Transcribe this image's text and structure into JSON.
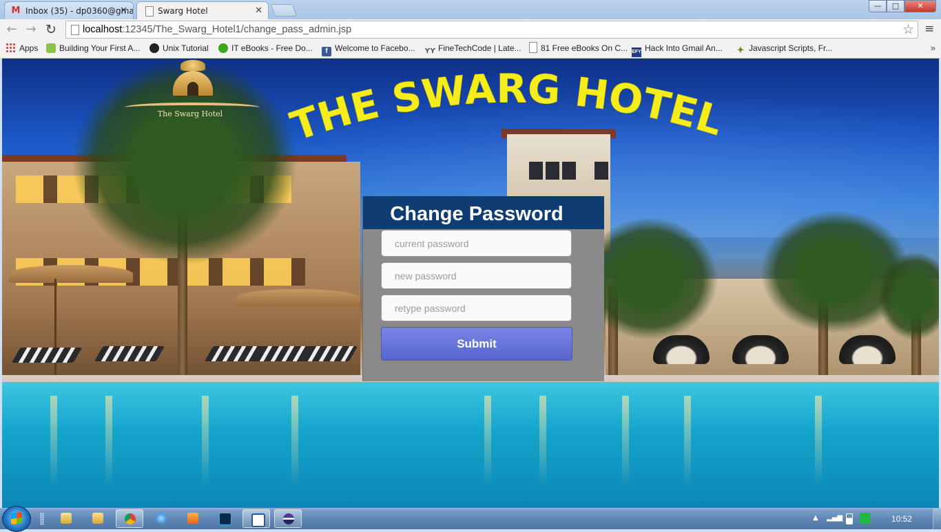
{
  "browser": {
    "tabs": [
      {
        "title": "Inbox (35) - dp0360@gma",
        "icon": "gmail-icon"
      },
      {
        "title": "Swarg Hotel",
        "icon": "page-icon"
      }
    ],
    "window_controls": {
      "minimize": "—",
      "maximize": "□",
      "close": "✕"
    },
    "url_host": "localhost",
    "url_rest": ":12345/The_Swarg_Hotel1/change_pass_admin.jsp",
    "bookmarks": [
      {
        "label": "Apps",
        "icon": "apps-grid-icon"
      },
      {
        "label": "Building Your First A...",
        "icon": "android-icon"
      },
      {
        "label": "Unix Tutorial",
        "icon": "unix-icon"
      },
      {
        "label": "IT eBooks - Free Do...",
        "icon": "green-ball-icon"
      },
      {
        "label": "Welcome to Facebo...",
        "icon": "facebook-icon"
      },
      {
        "label": "FineTechCode | Late...",
        "icon": "finetech-icon"
      },
      {
        "label": "81 Free eBooks On C...",
        "icon": "page-icon"
      },
      {
        "label": "Hack Into Gmail An...",
        "icon": "efy-icon"
      },
      {
        "label": "Javascript Scripts, Fr...",
        "icon": "js-icon"
      }
    ],
    "bookmarks_more": "»"
  },
  "page": {
    "logo_text": "The Swarg Hotel",
    "hotel_title": "THE SWARG HOTEL",
    "form": {
      "title": "Change Password",
      "current_placeholder": "current password",
      "new_placeholder": "new password",
      "retype_placeholder": "retype password",
      "submit_label": "Submit"
    }
  },
  "taskbar": {
    "apps": [
      "explorer-icon",
      "folders-icon",
      "chrome-icon",
      "ie-icon",
      "media-player-icon",
      "photoshop-icon",
      "word-icon",
      "eclipse-icon"
    ],
    "clock": "10:52"
  },
  "colors": {
    "form_header": "#0f3c72",
    "form_body": "#8a8a8a",
    "submit_button": "#6874d8",
    "title_yellow": "#f5ec1c"
  }
}
